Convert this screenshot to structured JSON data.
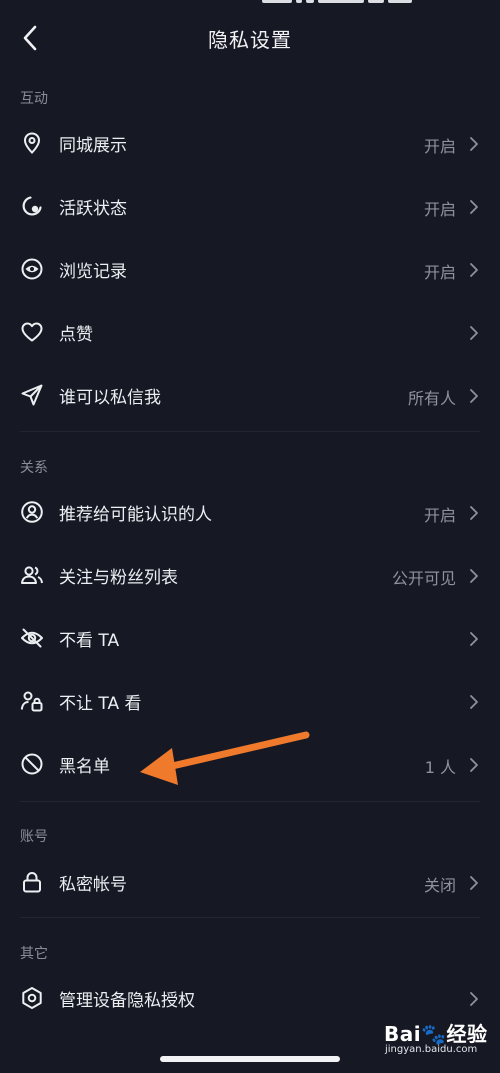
{
  "header": {
    "title": "隐私设置",
    "back_icon": "chevron-left-icon"
  },
  "sections": [
    {
      "title": "互动",
      "items": [
        {
          "icon": "location-pin-icon",
          "label": "同城展示",
          "value": "开启"
        },
        {
          "icon": "active-status-icon",
          "label": "活跃状态",
          "value": "开启"
        },
        {
          "icon": "eye-icon",
          "label": "浏览记录",
          "value": "开启"
        },
        {
          "icon": "heart-icon",
          "label": "点赞",
          "value": ""
        },
        {
          "icon": "paper-plane-icon",
          "label": "谁可以私信我",
          "value": "所有人"
        }
      ]
    },
    {
      "title": "关系",
      "items": [
        {
          "icon": "user-circle-icon",
          "label": "推荐给可能认识的人",
          "value": "开启"
        },
        {
          "icon": "users-icon",
          "label": "关注与粉丝列表",
          "value": "公开可见"
        },
        {
          "icon": "eye-off-icon",
          "label": "不看 TA",
          "value": ""
        },
        {
          "icon": "user-lock-icon",
          "label": "不让 TA 看",
          "value": ""
        },
        {
          "icon": "block-icon",
          "label": "黑名单",
          "value": "1 人"
        }
      ]
    },
    {
      "title": "账号",
      "items": [
        {
          "icon": "lock-icon",
          "label": "私密帐号",
          "value": "关闭"
        }
      ]
    },
    {
      "title": "其它",
      "items": [
        {
          "icon": "hexagon-shield-icon",
          "label": "管理设备隐私授权",
          "value": ""
        }
      ]
    }
  ],
  "annotation": {
    "color": "#f07a2c"
  },
  "watermark": {
    "logo": "Bai🐾经验",
    "url": "jingyan.baidu.com"
  },
  "colors": {
    "background": "#161824",
    "text": "#eceef2",
    "secondary": "#8f919b",
    "section_header": "#8b8d98"
  }
}
